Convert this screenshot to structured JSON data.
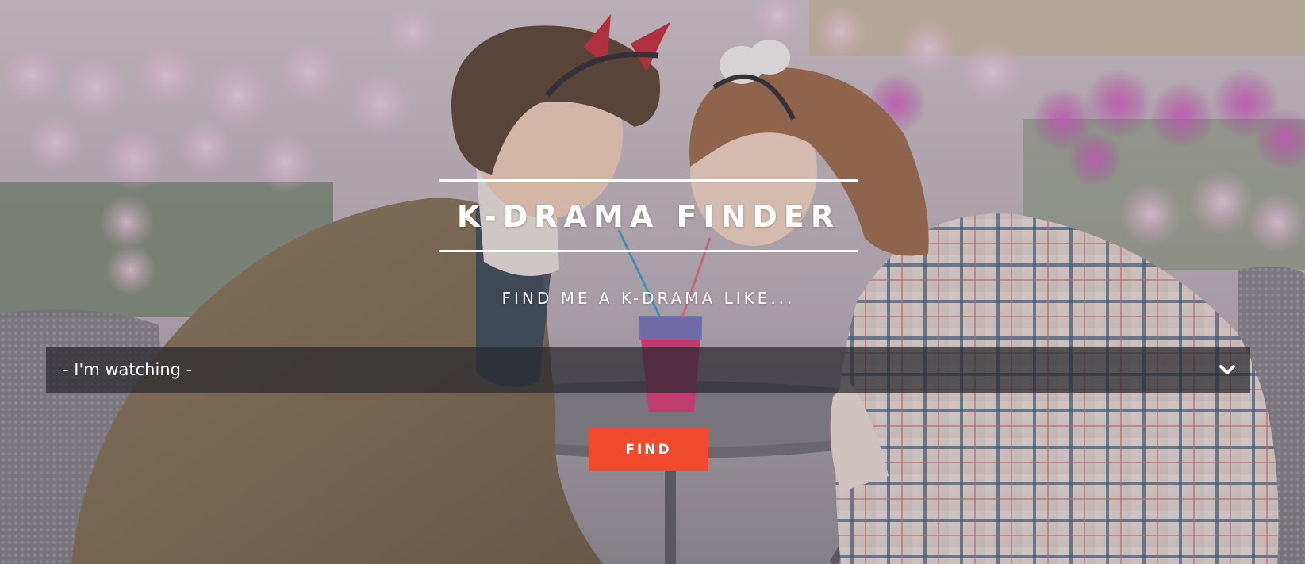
{
  "header": {
    "title": "K-DRAMA FINDER",
    "tagline": "FIND ME A K-DRAMA LIKE..."
  },
  "search": {
    "select_value": "- I'm watching -",
    "select_icon": "chevron-down-icon"
  },
  "actions": {
    "find_label": "FIND"
  },
  "hero": {
    "image_description_icon": "couple-photo-background"
  },
  "colors": {
    "accent": "#ef4a2e",
    "select_bg": "#28282e",
    "text": "#ffffff"
  }
}
